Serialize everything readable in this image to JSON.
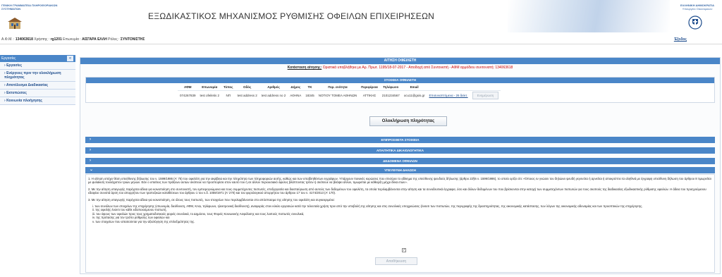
{
  "header": {
    "left_org": "ΓΕΝΙΚΗ ΓΡΑΜΜΑΤΕΙΑ ΠΛΗΡΟΦΟΡΙΑΚΩΝ ΣΥΣΤΗΜΑΤΩΝ",
    "title": "ΕΞΩΔΙΚΑΣΤΙΚΟΣ ΜΗΧΑΝΙΣΜΟΣ ΡΥΘΜΙΣΗΣ ΟΦΕΙΛΩΝ ΕΠΙΧΕΙΡΗΣΕΩΝ",
    "right_org_line1": "ΕΛΛΗΝΙΚΗ ΔΗΜΟΚΡΑΤΙΑ",
    "right_org_line2": "Υπουργείο Οικονομικών"
  },
  "userbar": {
    "afm_label": "Α.Φ.Μ. :",
    "afm_value": "134063618",
    "user_label": "Χρήστης :",
    "user_value": "rg1201",
    "company_label": "Επωνυμία :",
    "company_value": "ΑΙΣΓΑΡΑ ΕΛΛΗ",
    "role_label": "Ρόλος :",
    "role_value": "ΣΥΝΤΟΝΙΣΤΗΣ",
    "logout": "Έξοδος"
  },
  "sidebar": {
    "title": "Εργασίες",
    "toggle": "«",
    "items": [
      {
        "label": "Εργασίες"
      },
      {
        "label": "Ενέργειες πριν την ολοκλήρωση πληρότητας"
      },
      {
        "label": "Αποτέλεσμα Διαδικασίας"
      },
      {
        "label": "Εκτυπώσεις"
      },
      {
        "label": "Κοινωνία πλοήγησης"
      }
    ]
  },
  "main": {
    "title": "ΑΙΤΗΣΗ ΟΦΕΙΛΕΤΗ",
    "status_label": "Κατάσταση αίτησης:",
    "status_text": "Οριστικά υποβλήθηκε με Αρ. Πρωτ. 1195/18-07-2017 - Αποδοχή από Συντονιστή - ΑΦΜ αρμόδιου συντονιστή: 134063618",
    "debtor_panel_title": "ΣΤΟΙΧΕΙΑ ΟΦΕΙΛΕΤΗ",
    "debtor_columns": [
      "ΑΦΜ",
      "Επωνυμία",
      "Τύπος",
      "Οδός",
      "Αριθμός",
      "Δήμος",
      "ΤΚ",
      "Περ. ενότητα",
      "Περιφέρεια",
      "Τηλέφωνο",
      "Email"
    ],
    "debtor_row": [
      "074267839",
      "test ofeiletis 2",
      "ΝΠ",
      "test address 2",
      "test address no 2",
      "ΑΘΗΝΑ",
      "18345",
      "ΝΟΤΙΟΥ ΤΟΜΕΑ ΑΘΗΝΩΝ",
      "ΑΤΤΙΚΗΣ",
      "2101234567",
      "ocu11@gsis.gr"
    ],
    "attached_link": "Επισυναπτόμενα - 26 δείκτ.",
    "update_button": "Ενημέρωση",
    "complete_button": "Ολοκλήρωση πληρότητας",
    "sections": [
      {
        "label": "ΕΠΙΠΡΟΣΘΕΤΑ ΣΤΟΙΧΕΙΑ"
      },
      {
        "label": "ΑΠΑΙΤΗΤΙΚΑ ΔΙΚΑΙΟΛΟΓΗΤΙΚΑ"
      },
      {
        "label": "ΔΕΔΟΜΕΝΑ ΟΦΕΙΛΩΝ"
      }
    ],
    "declaration_title": "ΥΠΕΥΘΥΝΗ ΔΗΛΩΣΗ",
    "declaration_p1": "1. Η αίτηση υπέχει θέση υπεύθυνης δήλωσης του ν. 1599/1986 (Α' 75) του οφειλέτη για την ακρίβεια και την πληρότητα των πληροφοριών αυτής, καθώς και των υποβληθέντων εγγράφων. Υπάρχουν ποινικές κυρώσεις που επισύρει το αδίκημα της υπεύθυνης ψευδούς δήλωσης (άρθρο 22§6 ν. 1599/1986), το οποίο ορίζει ότι: «Όποιος εν γνώσει του δηλώνει ψευδή γεγονότα ή αρνείται ή αποκρύπτει τα αληθινά με έγγραφη υπεύθυνη δήλωση του άρθρου 8 τιμωρείται με φυλάκιση τουλάχιστον τριών μηνών. Εάν ο υπαίτιος των πράξεων αυτών σκόπευε να προσπορίσει στον εαυτό του ή σε άλλον περιουσιακό όφελος βλάπτοντας τρίτον ή σκόπευε να βλάψει άλλον, τιμωρείται με κάθειρξη μέχρι δέκα ετών».",
    "declaration_p2": "2. Με την αίτηση υπαγωγής παρέχεται άδεια για κοινοποίηση στο συντονιστή, τον εμπειρογνώμονα και τους συμμετέχοντες πιστωτές, επεξεργασία και διασταύρωση από αυτούς των δεδομένων του οφειλέτη, τα οποία περιλαμβάνονται στην αίτηση και τα συνοδευτικά έγγραφα, όσο και άλλων δεδομένων του που βρίσκονται στην κατοχή των συμμετεχόντων πιστωτών για τους σκοπούς της διαδικασίας εξωδικαστικής ρύθμισης οφειλών. Η άδεια του προηγούμενου εδαφίου συνιστά άρση του απορρήτου των τραπεζικών καταθέσεων του άρθρου 1 του ν.δ. 1059/1971 (Α' 270) και του φορολογικού απορρήτου του άρθρου 17 του ν. 4174/2013 (Α' 170).",
    "declaration_p3": "3. Με την αίτηση υπαγωγής παρέχεται άδεια για κοινοποίηση, σε όλους τους πιστωτές, των στοιχείων που περιλαμβάνονται στο απόσπασμα της αίτησης του οφειλέτη και συγκεκριμένα:",
    "declaration_items": [
      "i. των συνόλων των στοιχείων της επιχείρησης (επωνυμία, διεύθυνση, ΑΦΜ, ΚΑΔ, τηλέφωνο, ηλεκτρονική διεύθυνση), αναφοράς στον κύκλο εργασιών κατά την τελευταία χρήση πριν από την υποβολή της αίτησης και στις συνολικές υποχρεώσεις (έναντι των πιστωτών, της περιγραφής της δραστηριότητας, της οικονομικής κατάστασης, των λόγων της οικονομικής αδυναμίας και των προοπτικών της επιχείρησης,",
      "ii. της οφειλής έναντι του κάθε ειδοποιούμενου πιστωτή,",
      "iii. του ύψους των οφειλών προς τους χρηματοδοτικούς φορείς συνολικά, το Δημόσιο, τους Φορείς Κοινωνικής Ασφάλισης και τους λοιπούς πιστωτές συνολικά,",
      "iv. της πρότασης για τον τρόπο ρύθμισης των οφειλών και",
      "v. των στοιχείων που απαιτούνται για την αξιολόγηση της επιλεξιμότητας της."
    ],
    "checkbox_mark": "✓",
    "save_button": "Αποθήκευση"
  }
}
